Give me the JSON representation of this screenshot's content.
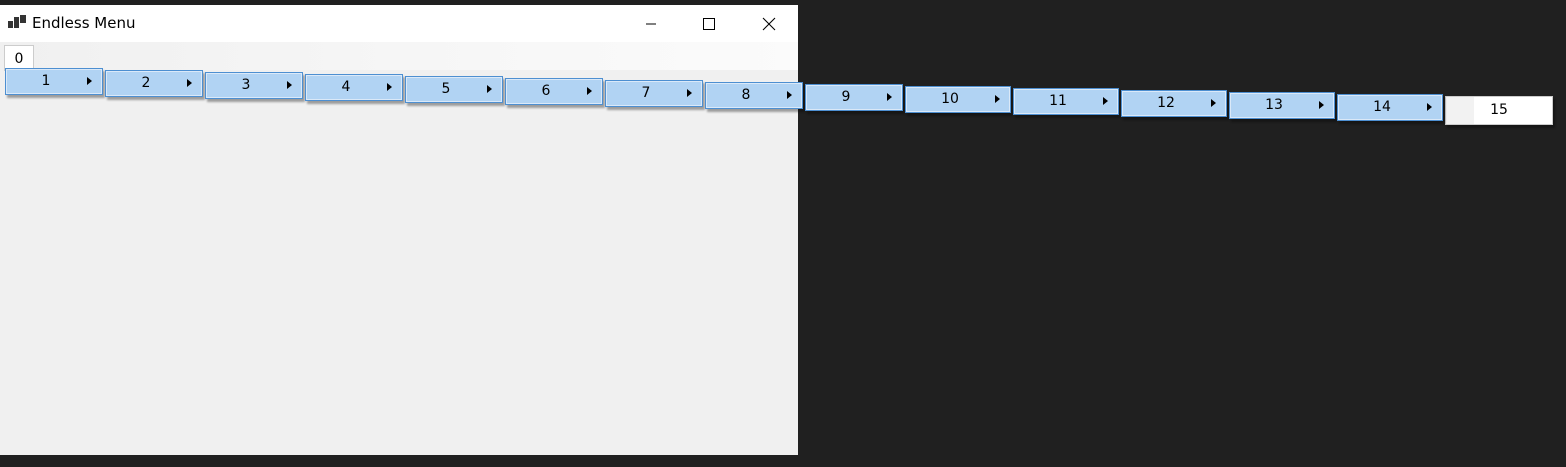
{
  "window": {
    "title": "Endless Menu",
    "controls": [
      "minimize",
      "maximize",
      "close"
    ]
  },
  "menu": {
    "root_label": "0",
    "submenu_items": [
      "1",
      "2",
      "3",
      "4",
      "5",
      "6",
      "7",
      "8",
      "9",
      "10",
      "11",
      "12",
      "13",
      "14"
    ],
    "last_item_label": "15"
  },
  "colors": {
    "highlight": "#b1d3f3",
    "highlight_border": "#4d8fd1",
    "desktop": "#202020",
    "window_bg": "#f0f0f0"
  }
}
